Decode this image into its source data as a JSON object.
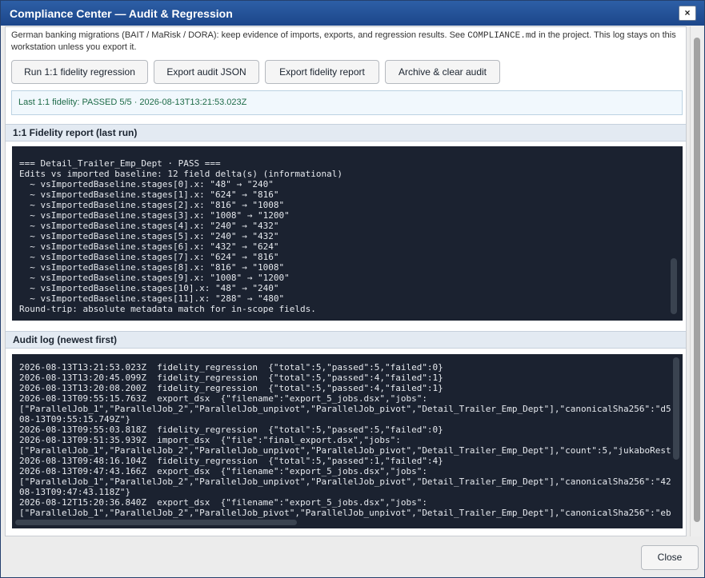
{
  "window": {
    "title": "Compliance Center — Audit & Regression",
    "close_glyph": "×"
  },
  "intro": {
    "text_before": "German banking migrations (BAIT / MaRisk / DORA): keep evidence of imports, exports, and regression results. See ",
    "code": "COMPLIANCE.md",
    "text_after": " in the project. This log stays on this workstation unless you export it."
  },
  "toolbar": {
    "run_regression": "Run 1:1 fidelity regression",
    "export_audit": "Export audit JSON",
    "export_fidelity": "Export fidelity report",
    "archive_clear": "Archive & clear audit"
  },
  "status": "Last 1:1 fidelity: PASSED 5/5 · 2026-08-13T13:21:53.023Z",
  "fidelity": {
    "heading": "1:1 Fidelity report (last run)",
    "lines": [
      "",
      "=== Detail_Trailer_Emp_Dept · PASS ===",
      "Edits vs imported baseline: 12 field delta(s) (informational)",
      "  ~ vsImportedBaseline.stages[0].x: \"48\" → \"240\"",
      "  ~ vsImportedBaseline.stages[1].x: \"624\" → \"816\"",
      "  ~ vsImportedBaseline.stages[2].x: \"816\" → \"1008\"",
      "  ~ vsImportedBaseline.stages[3].x: \"1008\" → \"1200\"",
      "  ~ vsImportedBaseline.stages[4].x: \"240\" → \"432\"",
      "  ~ vsImportedBaseline.stages[5].x: \"240\" → \"432\"",
      "  ~ vsImportedBaseline.stages[6].x: \"432\" → \"624\"",
      "  ~ vsImportedBaseline.stages[7].x: \"624\" → \"816\"",
      "  ~ vsImportedBaseline.stages[8].x: \"816\" → \"1008\"",
      "  ~ vsImportedBaseline.stages[9].x: \"1008\" → \"1200\"",
      "  ~ vsImportedBaseline.stages[10].x: \"48\" → \"240\"",
      "  ~ vsImportedBaseline.stages[11].x: \"288\" → \"480\"",
      "Round-trip: absolute metadata match for in-scope fields."
    ]
  },
  "audit": {
    "heading": "Audit log (newest first)",
    "lines": [
      "2026-08-13T13:21:53.023Z  fidelity_regression  {\"total\":5,\"passed\":5,\"failed\":0}",
      "2026-08-13T13:20:45.099Z  fidelity_regression  {\"total\":5,\"passed\":4,\"failed\":1}",
      "2026-08-13T13:20:08.200Z  fidelity_regression  {\"total\":5,\"passed\":4,\"failed\":1}",
      "2026-08-13T09:55:15.763Z  export_dsx  {\"filename\":\"export_5_jobs.dsx\",\"jobs\":",
      "[\"ParallelJob_1\",\"ParallelJob_2\",\"ParallelJob_unpivot\",\"ParallelJob_pivot\",\"Detail_Trailer_Emp_Dept\"],\"canonicalSha256\":\"d5",
      "08-13T09:55:15.749Z\"}",
      "2026-08-13T09:55:03.818Z  fidelity_regression  {\"total\":5,\"passed\":5,\"failed\":0}",
      "2026-08-13T09:51:35.939Z  import_dsx  {\"file\":\"final_export.dsx\",\"jobs\":",
      "[\"ParallelJob_1\",\"ParallelJob_2\",\"ParallelJob_unpivot\",\"ParallelJob_pivot\",\"Detail_Trailer_Emp_Dept\"],\"count\":5,\"jukaboRest",
      "2026-08-13T09:48:16.104Z  fidelity_regression  {\"total\":5,\"passed\":1,\"failed\":4}",
      "2026-08-13T09:47:43.166Z  export_dsx  {\"filename\":\"export_5_jobs.dsx\",\"jobs\":",
      "[\"ParallelJob_1\",\"ParallelJob_2\",\"ParallelJob_unpivot\",\"ParallelJob_pivot\",\"Detail_Trailer_Emp_Dept\"],\"canonicalSha256\":\"42",
      "08-13T09:47:43.118Z\"}",
      "2026-08-12T15:20:36.840Z  export_dsx  {\"filename\":\"export_5_jobs.dsx\",\"jobs\":",
      "[\"ParallelJob_1\",\"ParallelJob_2\",\"ParallelJob_pivot\",\"ParallelJob_unpivot\",\"Detail_Trailer_Emp_Dept\"],\"canonicalSha256\":\"eb"
    ]
  },
  "footer": {
    "close": "Close"
  },
  "colors": {
    "title_bar": "#1c468a",
    "terminal_bg": "#1b2230",
    "status_text": "#1e6b48",
    "section_header_bg": "#e3eaf2"
  }
}
